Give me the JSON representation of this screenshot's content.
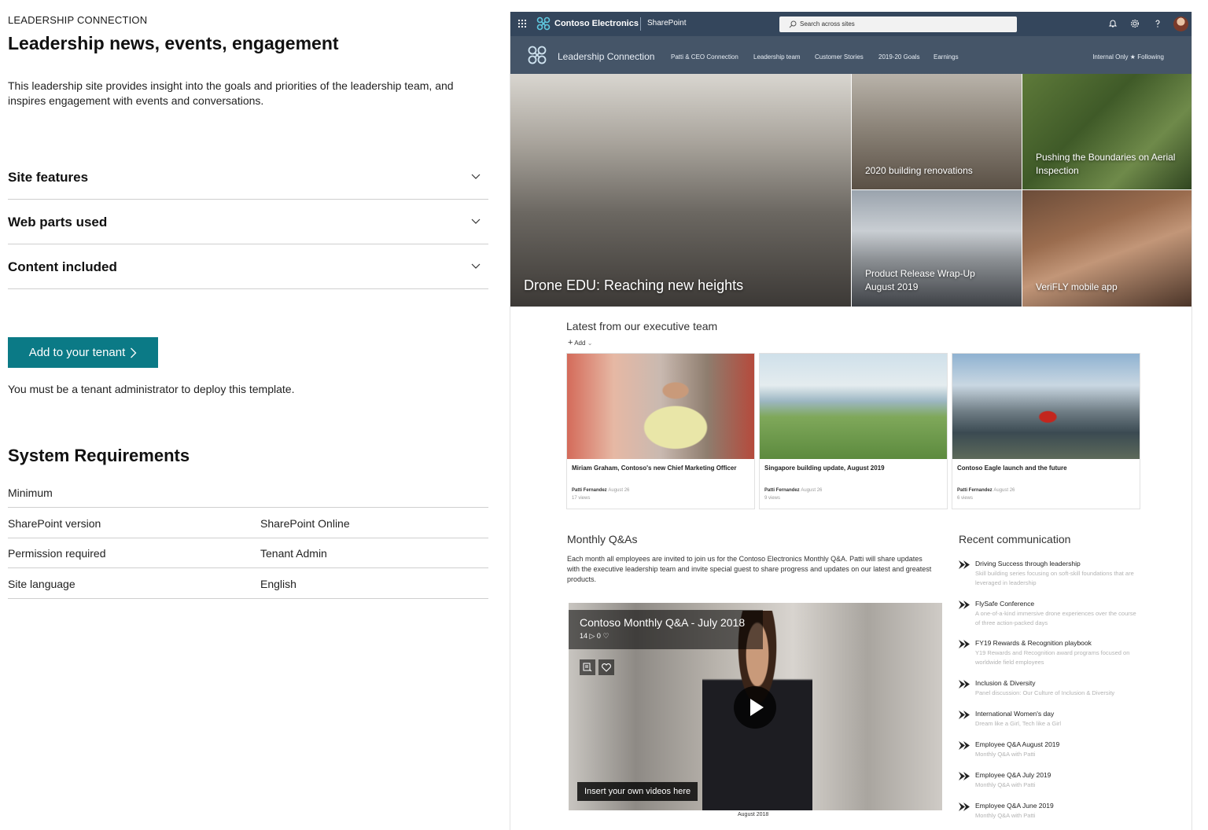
{
  "left": {
    "eyebrow": "LEADERSHIP CONNECTION",
    "title": "Leadership news, events, engagement",
    "description": "This leadership site provides insight into the goals and priorities of the leadership team, and inspires engagement with events and conversations.",
    "accordions": [
      "Site features",
      "Web parts used",
      "Content included"
    ],
    "add_button": "Add to your tenant",
    "note": "You must be a tenant administrator to deploy this template.",
    "sysreq_title": "System Requirements",
    "requirements": [
      {
        "key": "Minimum",
        "value": ""
      },
      {
        "key": "SharePoint version",
        "value": "SharePoint Online"
      },
      {
        "key": "Permission required",
        "value": "Tenant Admin"
      },
      {
        "key": "Site language",
        "value": "English"
      }
    ]
  },
  "preview": {
    "suitebar": {
      "org": "Contoso Electronics",
      "app": "SharePoint",
      "search_placeholder": "Search across sites",
      "icons": [
        "waffle-icon",
        "bell-icon",
        "gear-icon",
        "help-icon",
        "avatar"
      ]
    },
    "sitebar": {
      "name": "Leadership Connection",
      "nav": [
        "Patti & CEO Connection",
        "Leadership team",
        "Customer Stories",
        "2019-20 Goals",
        "Earnings"
      ],
      "internal": "Internal Only",
      "following": "Following"
    },
    "hero": [
      "Drone EDU: Reaching new heights",
      "2020 building renovations",
      "Pushing the Boundaries on Aerial Inspection",
      "Product Release Wrap-Up August 2019",
      "VeriFLY mobile app"
    ],
    "latest": {
      "title": "Latest from our executive team",
      "add": "Add",
      "cards": [
        {
          "title": "Miriam Graham, Contoso's new Chief Marketing Officer",
          "author": "Patti Fernandez",
          "date": "August 26",
          "views": "17 views"
        },
        {
          "title": "Singapore building update, August 2019",
          "author": "Patti Fernandez",
          "date": "August 26",
          "views": "9 views"
        },
        {
          "title": "Contoso Eagle launch and the future",
          "author": "Patti Fernandez",
          "date": "August 26",
          "views": "6 views"
        }
      ]
    },
    "qa": {
      "title": "Monthly Q&As",
      "description": "Each month all employees are invited to join us for the Contoso Electronics Monthly Q&A. Patti will share updates with the executive leadership team and invite special guest to share progress and updates on our latest and greatest products.",
      "video_title": "Contoso Monthly Q&A - July 2018",
      "video_stats": "14 ▷   0 ♡",
      "insert_label": "Insert your own videos here",
      "caption": "August 2018"
    },
    "recent": {
      "title": "Recent communication",
      "items": [
        {
          "title": "Driving Success through leadership",
          "sub": "Skill building series focusing on soft-skill foundations that are leveraged in leadership"
        },
        {
          "title": "FlySafe Conference",
          "sub": "A one-of-a-kind immersive drone experiences over the course of three action-packed days"
        },
        {
          "title": "FY19 Rewards & Recognition playbook",
          "sub": "Y19 Rewards and Recognition award programs focused on worldwide field employees"
        },
        {
          "title": "Inclusion & Diversity",
          "sub": "Panel discussion: Our Culture of Inclusion & Diversity"
        },
        {
          "title": "International Women's day",
          "sub": "Dream like a Girl, Tech like a Girl"
        },
        {
          "title": "Employee Q&A August 2019",
          "sub": "Monthly Q&A with Patti"
        },
        {
          "title": "Employee Q&A July 2019",
          "sub": "Monthly Q&A with Patti"
        },
        {
          "title": "Employee Q&A June 2019",
          "sub": "Monthly Q&A with Patti"
        }
      ]
    }
  },
  "colors": {
    "accent": "#0b7a86",
    "suitebar": "#34465c",
    "sitebar": "#455568"
  }
}
